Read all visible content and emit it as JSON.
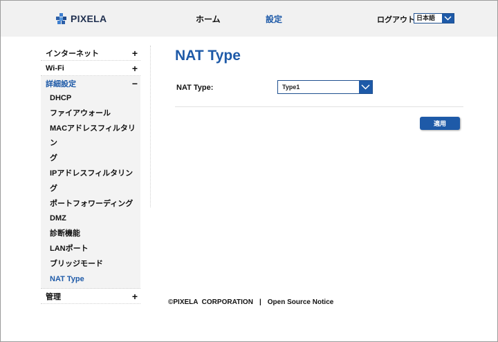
{
  "header": {
    "logo_text": "PIXELA",
    "nav": {
      "home": "ホーム",
      "settings": "設定"
    },
    "logout": "ログアウト",
    "language": {
      "selected": "日本語"
    }
  },
  "sidebar": {
    "sections": [
      {
        "label": "インターネット",
        "sign": "+"
      },
      {
        "label": "Wi-Fi",
        "sign": "+"
      },
      {
        "label": "詳細設定",
        "sign": "−"
      },
      {
        "label": "管理",
        "sign": "+"
      }
    ],
    "advanced_items": [
      "DHCP",
      "ファイアウォール",
      "MACアドレスフィルタリン",
      "グ",
      "IPアドレスフィルタリング",
      "ポートフォワーディング",
      "DMZ",
      "診断機能",
      "LANポート",
      "ブリッジモード",
      "NAT Type"
    ]
  },
  "main": {
    "title": "NAT Type",
    "nat_type_label": "NAT Type:",
    "nat_type_value": "Type1",
    "apply_label": "適用"
  },
  "footer": {
    "copyright": "©PIXELA  CORPORATION",
    "separator": "|",
    "oss_link": "Open Source Notice"
  },
  "colors": {
    "accent": "#1e5aa8",
    "header_bg": "#f1f1f1",
    "sidebar_bg": "#f3f3f3"
  }
}
